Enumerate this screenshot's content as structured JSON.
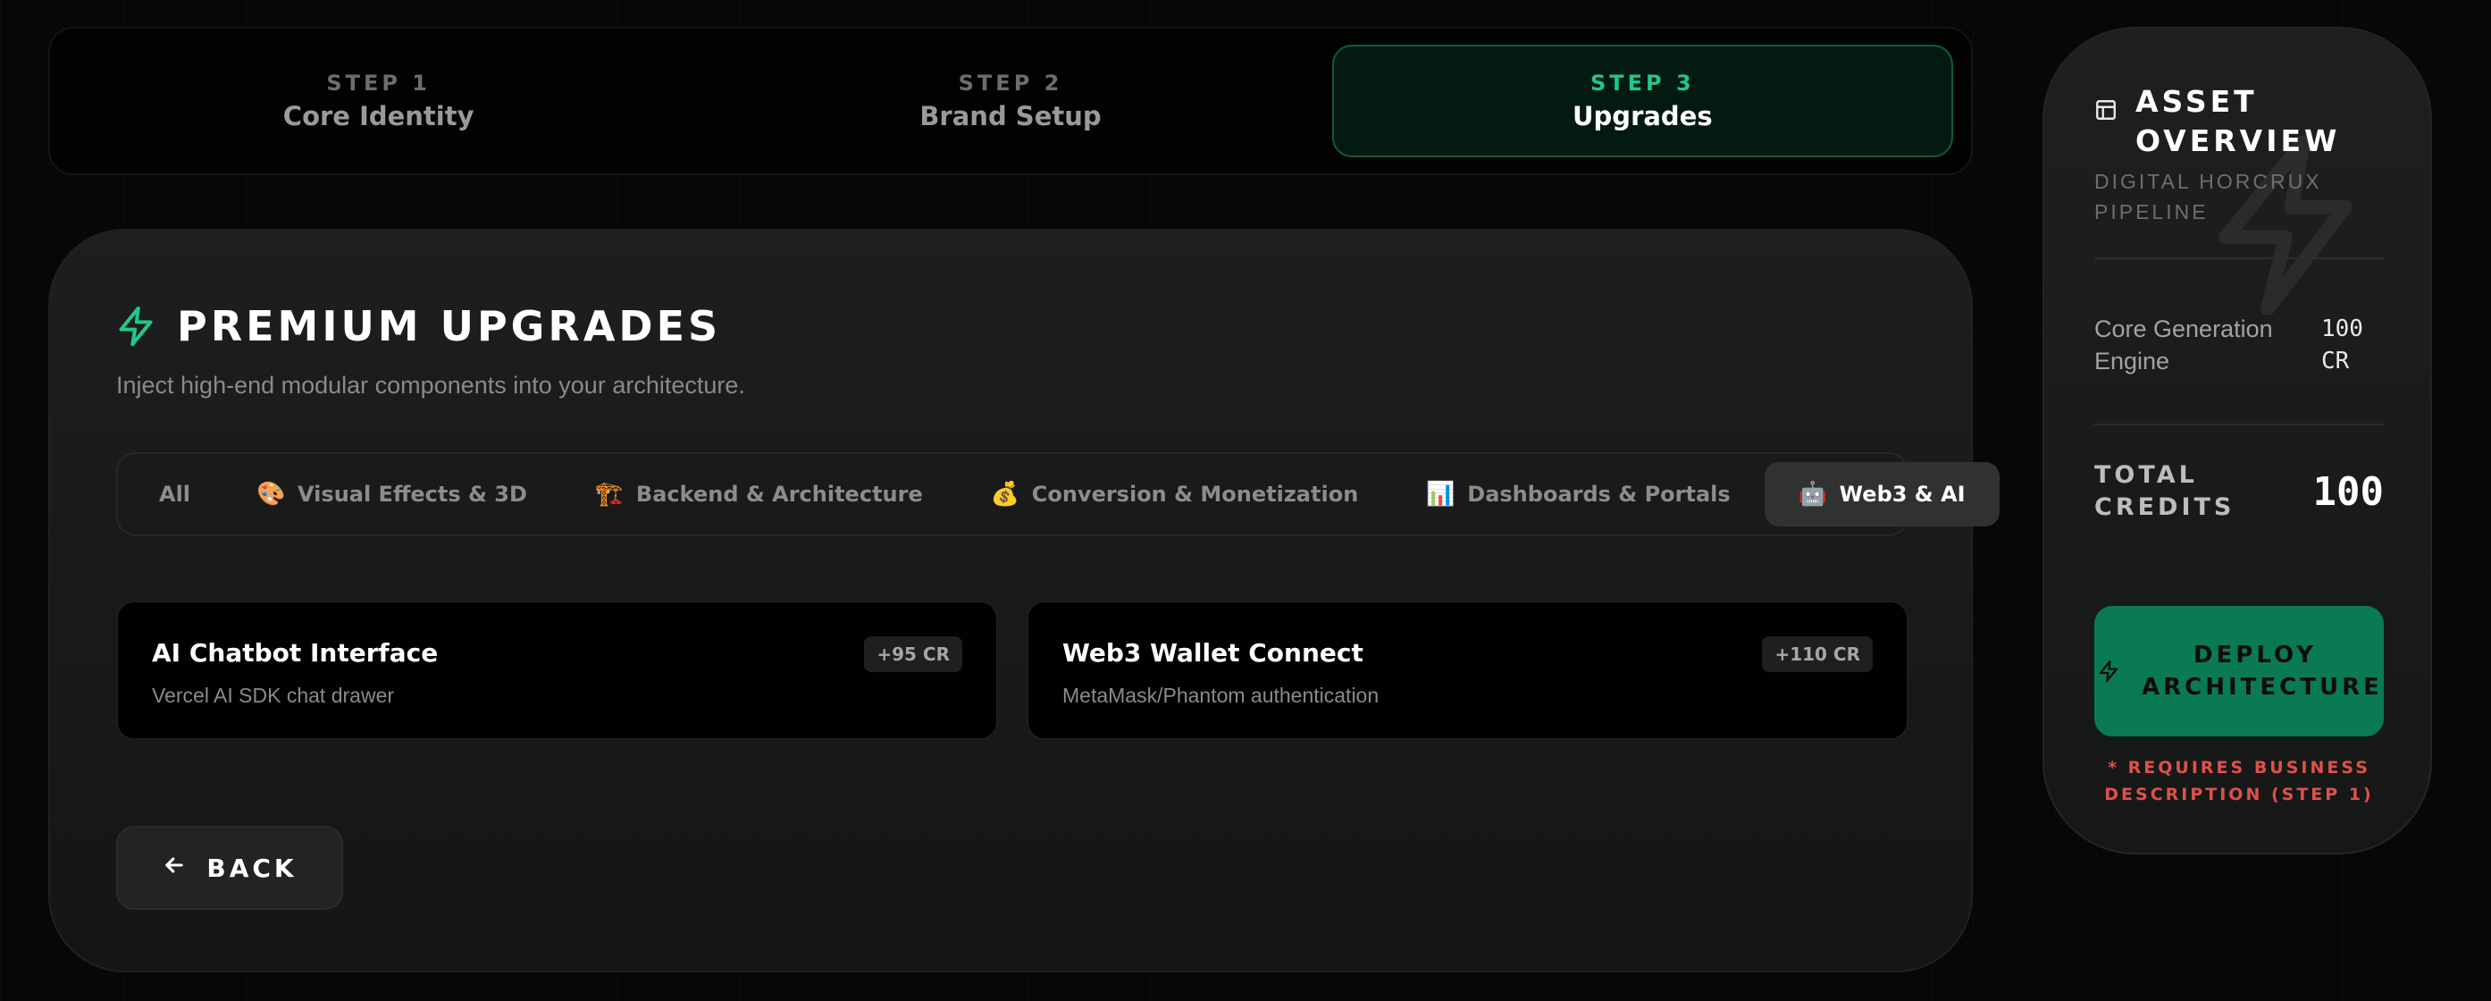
{
  "stepper": {
    "steps": [
      {
        "number": "STEP 1",
        "name": "Core Identity",
        "active": false
      },
      {
        "number": "STEP 2",
        "name": "Brand Setup",
        "active": false
      },
      {
        "number": "STEP 3",
        "name": "Upgrades",
        "active": true
      }
    ]
  },
  "main": {
    "title": "PREMIUM UPGRADES",
    "title_icon": "lightning-bolt-icon",
    "subtitle": "Inject high-end modular components into your architecture.",
    "tabs": [
      {
        "label": "All",
        "icon": "",
        "active": false
      },
      {
        "label": "Visual Effects & 3D",
        "icon": "🎨",
        "active": false
      },
      {
        "label": "Backend & Architecture",
        "icon": "🏗️",
        "active": false
      },
      {
        "label": "Conversion & Monetization",
        "icon": "💰",
        "active": false
      },
      {
        "label": "Dashboards & Portals",
        "icon": "📊",
        "active": false
      },
      {
        "label": "Web3 & AI",
        "icon": "🤖",
        "active": true
      }
    ],
    "cards": [
      {
        "title": "AI Chatbot Interface",
        "description": "Vercel AI SDK chat drawer",
        "cost": "+95 CR"
      },
      {
        "title": "Web3 Wallet Connect",
        "description": "MetaMask/Phantom authentication",
        "cost": "+110 CR"
      }
    ],
    "back_label": "BACK"
  },
  "overview": {
    "title": "ASSET OVERVIEW",
    "subtitle": "DIGITAL HORCRUX PIPELINE",
    "line_items": [
      {
        "label": "Core Generation Engine",
        "value": "100 CR"
      }
    ],
    "total_label": "TOTAL CREDITS",
    "total_value": "100",
    "deploy_label": "DEPLOY ARCHITECTURE",
    "requirement_note": "* REQUIRES BUSINESS DESCRIPTION (STEP 1)"
  },
  "colors": {
    "accent": "#20c886",
    "deploy_bg": "#0a7a55",
    "warning": "#e0514a",
    "background": "#070707"
  }
}
